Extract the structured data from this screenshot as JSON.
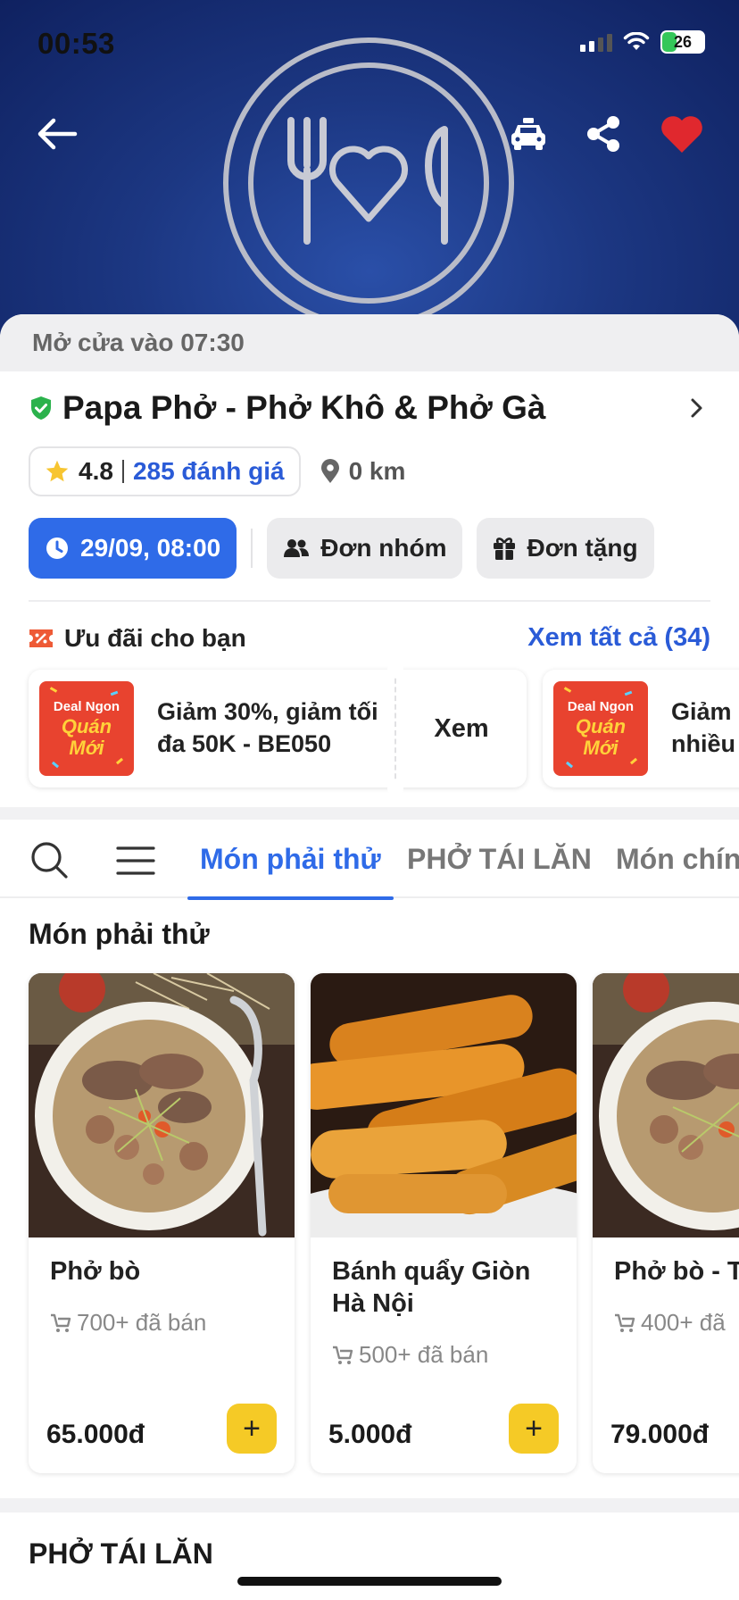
{
  "status_bar": {
    "time": "00:53",
    "battery": "26"
  },
  "restaurant": {
    "open_notice": "Mở cửa vào 07:30",
    "name": "Papa Phở - Phở Khô & Phở Gà",
    "rating": "4.8",
    "reviews": "285 đánh giá",
    "distance": "0 km"
  },
  "chips": {
    "schedule": "29/09, 08:00",
    "group_order": "Đơn nhóm",
    "gift_order": "Đơn tặng"
  },
  "promotions": {
    "title": "Ưu đãi cho bạn",
    "see_all": "Xem tất cả (34)",
    "badge": {
      "line1": "Deal Ngon",
      "line2": "Quán",
      "line3": "Mới"
    },
    "items": [
      {
        "text": "Giảm 30%, giảm tối đa 50K - BE050",
        "action": "Xem"
      },
      {
        "text": "Giảm nhiều"
      }
    ]
  },
  "tabs": [
    "Món phải thử",
    "PHỞ TÁI LĂN",
    "Món chính"
  ],
  "section": {
    "title": "Món phải thử",
    "items": [
      {
        "name": "Phở bò",
        "sold": "700+ đã bán",
        "price": "65.000đ"
      },
      {
        "name": "Bánh quẩy Giòn Hà Nội",
        "sold": "500+ đã bán",
        "price": "5.000đ"
      },
      {
        "name": "Phở bò - Tl",
        "sold": "400+ đã",
        "price": "79.000đ"
      }
    ]
  },
  "next_section": {
    "title": "PHỞ TÁI LĂN"
  },
  "add_label": "+",
  "colors": {
    "accent": "#2f6be8",
    "add_button": "#f5ca26",
    "favorite": "#e0282e",
    "hero": "#1c3782"
  },
  "icons": [
    "back-arrow-icon",
    "taxi-icon",
    "share-icon",
    "heart-icon",
    "verified-icon",
    "chevron-right-icon",
    "star-icon",
    "location-pin-icon",
    "clock-icon",
    "group-icon",
    "gift-icon",
    "discount-icon",
    "search-icon",
    "menu-icon",
    "cart-icon"
  ]
}
